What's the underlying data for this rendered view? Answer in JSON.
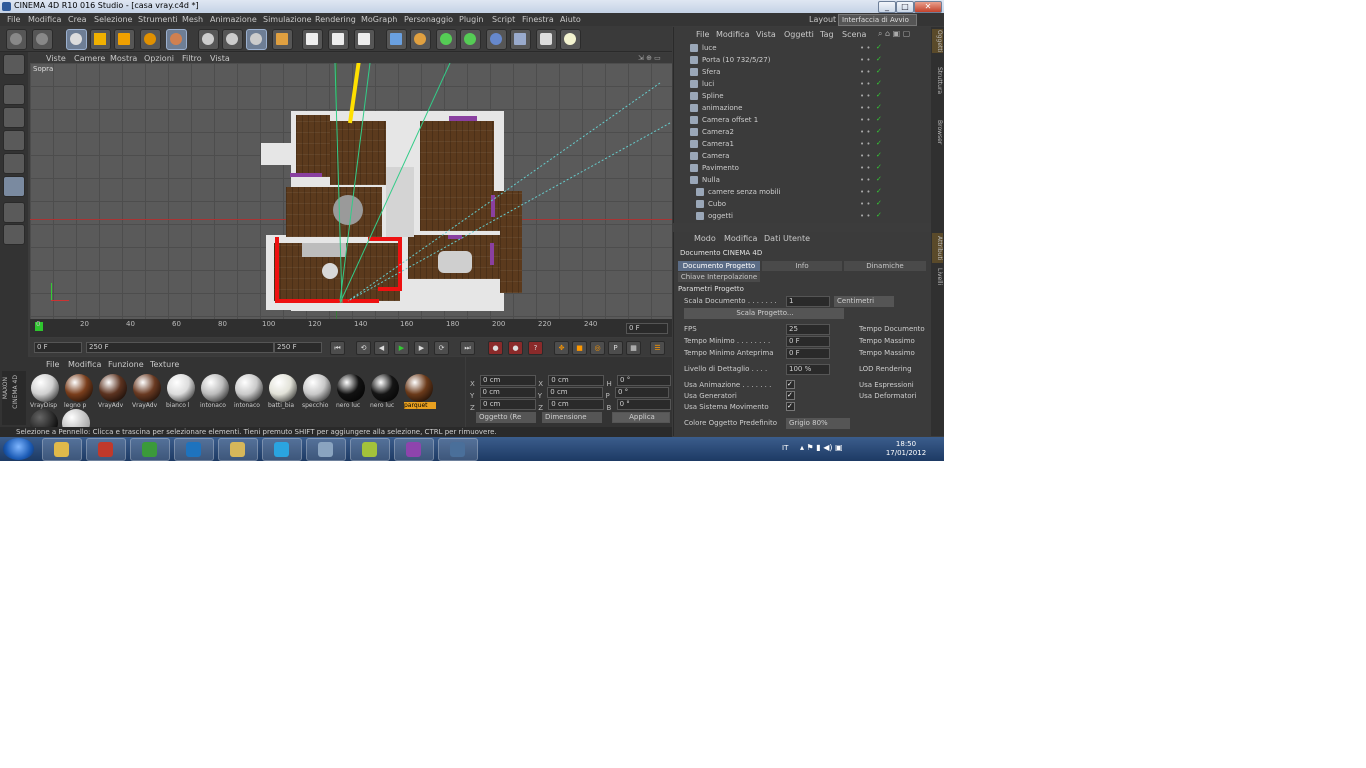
{
  "window": {
    "title": "CINEMA 4D R10 016 Studio - [casa vray.c4d *]",
    "controls": [
      "_",
      "□",
      "✕"
    ]
  },
  "menubar": {
    "items": [
      "File",
      "Modifica",
      "Crea",
      "Selezione",
      "Strumenti",
      "Mesh",
      "Animazione",
      "Simulazione",
      "Rendering",
      "MoGraph",
      "Personaggio",
      "Plugin",
      "Script",
      "Finestra",
      "Aiuto"
    ],
    "layout_label": "Layout",
    "layout_value": "Interfaccia di Avvio"
  },
  "viewport": {
    "menu": [
      "Viste",
      "Camere",
      "Mostra",
      "Opzioni",
      "Filtro",
      "Vista"
    ],
    "label": "Sopra"
  },
  "timeline": {
    "ticks": [
      "0",
      "20",
      "40",
      "60",
      "80",
      "100",
      "120",
      "140",
      "160",
      "180",
      "200",
      "220",
      "240"
    ],
    "current_frame": "0 F",
    "start_field": "0 F",
    "end_field": "250 F",
    "preview_field": "250 F"
  },
  "material_manager": {
    "menu": [
      "File",
      "Modifica",
      "Funzione",
      "Texture"
    ],
    "materials": [
      {
        "name": "VrayDisp",
        "color": "#d0d0d0"
      },
      {
        "name": "legno p",
        "color": "#7a3e1c"
      },
      {
        "name": "VrayAdv",
        "color": "#5c3320"
      },
      {
        "name": "VrayAdv",
        "color": "#6a3a22"
      },
      {
        "name": "bianco l",
        "color": "#dcdcdc"
      },
      {
        "name": "intonaco",
        "color": "#bcbcbc"
      },
      {
        "name": "intonaco",
        "color": "#cacaca"
      },
      {
        "name": "batti_bia",
        "color": "#e2e2d8"
      },
      {
        "name": "specchio",
        "color": "#c8c8c8"
      },
      {
        "name": "nero luc",
        "color": "#111111"
      },
      {
        "name": "nero luc",
        "color": "#151515"
      },
      {
        "name": "parquet",
        "color": "#6b3a1a"
      }
    ],
    "brand_top": "MAXON",
    "brand_bottom": "CINEMA 4D"
  },
  "coordinates": {
    "rows": [
      {
        "a": "X",
        "av": "0 cm",
        "b": "X",
        "bv": "0 cm",
        "c": "H",
        "cv": "0 °"
      },
      {
        "a": "Y",
        "av": "0 cm",
        "b": "Y",
        "bv": "0 cm",
        "c": "P",
        "cv": "0 °"
      },
      {
        "a": "Z",
        "av": "0 cm",
        "b": "Z",
        "bv": "0 cm",
        "c": "B",
        "cv": "0 °"
      }
    ],
    "mode": "Oggetto (Re",
    "size_mode": "Dimensione",
    "apply": "Applica"
  },
  "statusbar": {
    "text": "Selezione a Pennello: Clicca e trascina per selezionare elementi. Tieni premuto SHIFT per aggiungere alla selezione, CTRL per rimuovere."
  },
  "object_manager": {
    "menu": [
      "File",
      "Modifica",
      "Vista",
      "Oggetti",
      "Tag",
      "Scena"
    ],
    "objects": [
      "luce",
      "Porta (10 732/5/27)",
      "Sfera",
      "luci",
      "Spline",
      "animazione",
      "Camera offset 1",
      "Camera2",
      "Camera1",
      "Camera",
      "Pavimento",
      "Nulla",
      "camere senza mobili",
      "Cubo",
      "oggetti"
    ]
  },
  "attribute_manager": {
    "menu": [
      "Modo",
      "Modifica",
      "Dati Utente"
    ],
    "title": "Documento CINEMA 4D",
    "tabs": [
      "Documento Progetto",
      "Info",
      "Dinamiche"
    ],
    "subtab": "Chiave Interpolazione",
    "section": "Parametri Progetto",
    "scale_label": "Scala Documento . . . . . . .",
    "scale_value": "1",
    "scale_unit": "Centimetri",
    "scale_button": "Scala Progetto...",
    "fps_label": "FPS",
    "fps_value": "25",
    "min_time_label": "Tempo Minimo . . . . . . . .",
    "min_time_value": "0 F",
    "min_preview_label": "Tempo Minimo Anteprima",
    "min_preview_value": "0 F",
    "detail_label": "Livello di Dettaglio . . . .",
    "detail_value": "100 %",
    "doc_time": "Tempo Documento",
    "max_time": "Tempo Massimo",
    "max_time2": "Tempo Massimo",
    "lod": "LOD Rendering",
    "use_anim": "Usa Animazione . . . . . . .",
    "use_gen": "Usa Generatori",
    "use_move": "Usa Sistema Movimento",
    "use_expr": "Usa Espressioni",
    "use_deform": "Usa Deformatori",
    "color_label": "Colore Oggetto Predefinito",
    "color_value": "Grigio 80%"
  },
  "side_tabs": {
    "top": [
      "Oggetti",
      "Struttura",
      "Browser",
      "Layer"
    ],
    "bottom": [
      "Attributi",
      "Livelli"
    ]
  },
  "taskbar": {
    "time": "18:50",
    "date": "17/01/2012",
    "lang": "IT",
    "apps": [
      {
        "name": "explorer-app",
        "color": "#e0b94a"
      },
      {
        "name": "acrobat-app",
        "color": "#c0392b"
      },
      {
        "name": "chrome-app",
        "color": "#3b9a3b"
      },
      {
        "name": "photoshop-app",
        "color": "#1e73be"
      },
      {
        "name": "folder-app",
        "color": "#d6b75a"
      },
      {
        "name": "skype-app",
        "color": "#2aa4e0"
      },
      {
        "name": "network-app",
        "color": "#8aa4c0"
      },
      {
        "name": "puzzle-app",
        "color": "#a3c23b"
      },
      {
        "name": "media-app",
        "color": "#8e44ad"
      },
      {
        "name": "cinema4d-app",
        "color": "#4a6f9a"
      }
    ]
  }
}
